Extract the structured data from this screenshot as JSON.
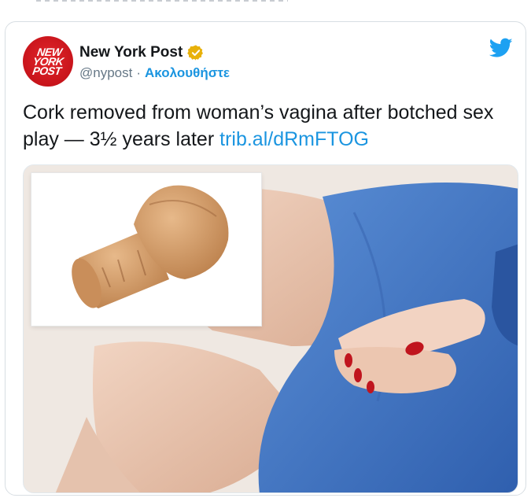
{
  "tweet": {
    "account_name": "New York Post",
    "handle": "@nypost",
    "separator": "·",
    "follow_label": "Ακολουθήστε",
    "avatar_logo": [
      "NEW",
      "YORK",
      "POST"
    ],
    "text": "Cork removed from woman’s vagina after botched sex play — 3½ years later",
    "link": "trib.al/dRmFTOG",
    "verified_icon": "verified-badge-icon",
    "brand_icon": "twitter-bird-icon"
  },
  "colors": {
    "link": "#1b95e0",
    "verified": "#e8b10a",
    "avatar": "#d01920",
    "garment": "#4a7bc8",
    "nail": "#c0151e"
  }
}
